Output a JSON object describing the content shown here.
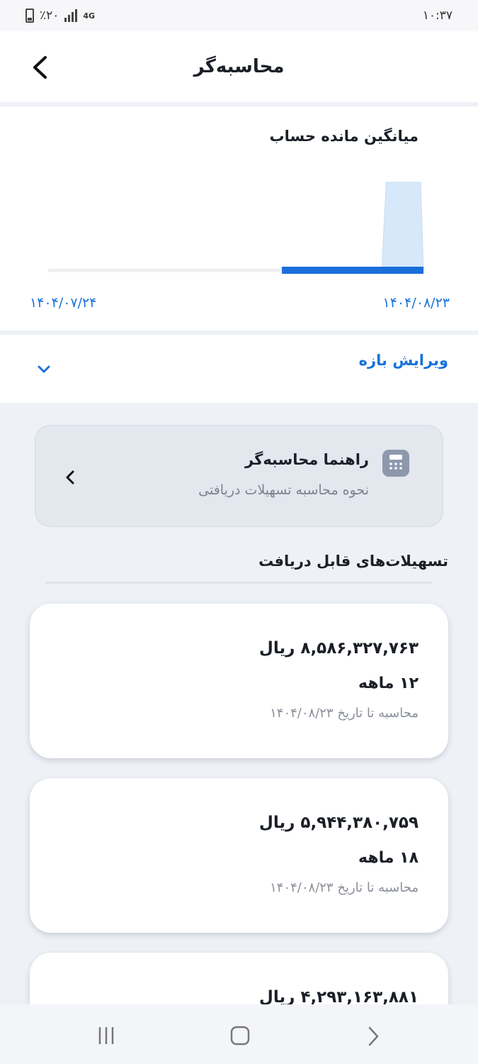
{
  "status_bar": {
    "battery": "٪۲۰",
    "network": "4G",
    "time": "۱۰:۳۷"
  },
  "header": {
    "title": "محاسبه‌گر",
    "back_icon": "chevron-left-icon"
  },
  "chart_data": {
    "type": "area",
    "title": "میانگین مانده حساب",
    "x_start_label": "۱۴۰۴/۰۷/۲۴",
    "x_end_label": "۱۴۰۴/۰۸/۲۳",
    "grid": false,
    "series": [
      {
        "values": [
          0,
          0,
          0,
          0,
          0,
          0,
          0,
          0.08,
          0.08,
          0.08,
          1.0,
          1.0
        ]
      }
    ],
    "colors": {
      "fill": "#d6e8f9",
      "line": "#1a6fd8",
      "baseline": "#eef0f3"
    }
  },
  "edit_range": {
    "label": "ویرایش بازه",
    "icon": "chevron-down-icon"
  },
  "guide": {
    "title": "راهنما محاسبه‌گر",
    "subtitle": "نحوه محاسبه تسهیلات دریافتی",
    "icon": "calculator-icon"
  },
  "section": {
    "title": "تسهیلات‌های قابل دریافت"
  },
  "facilities": [
    {
      "amount": "۸,۵۸۶,۳۲۷,۷۶۳ ریال",
      "duration": "۱۲ ماهه",
      "date": "محاسبه تا تاریخ ۱۴۰۴/۰۸/۲۳"
    },
    {
      "amount": "۵,۹۴۴,۳۸۰,۷۵۹ ریال",
      "duration": "۱۸ ماهه",
      "date": "محاسبه تا تاریخ ۱۴۰۴/۰۸/۲۳"
    },
    {
      "amount": "۴,۲۹۳,۱۶۳,۸۸۱ ریال"
    }
  ],
  "colors": {
    "accent": "#1a73d9",
    "background": "#eef1f6",
    "card": "#ffffff"
  }
}
